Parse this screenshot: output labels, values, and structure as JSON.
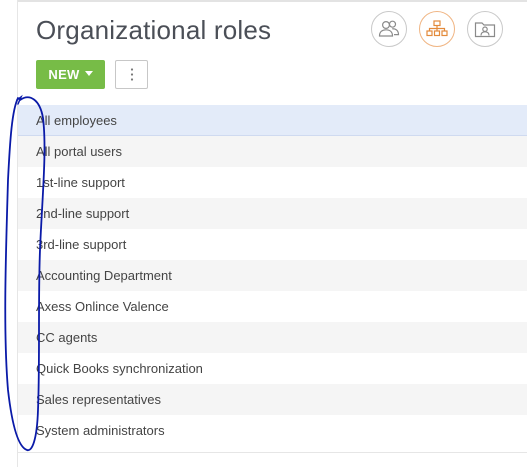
{
  "header": {
    "title": "Organizational roles",
    "view_buttons": [
      {
        "icon": "users-icon"
      },
      {
        "icon": "org-chart-icon",
        "active": true
      },
      {
        "icon": "user-folder-icon"
      }
    ]
  },
  "toolbar": {
    "new_label": "NEW",
    "more_icon": "vertical-dots-icon"
  },
  "roles": [
    "All employees",
    "All portal users",
    "1st-line support",
    "2nd-line support",
    "3rd-line support",
    "Accounting Department",
    "Axess Onlince Valence",
    "CC agents",
    "Quick Books synchronization",
    "Sales representatives",
    "System administrators"
  ],
  "selected_index": 0,
  "colors": {
    "new_button": "#77bc47",
    "selected_row": "#e3ebf9",
    "alt_row": "#f5f5f5",
    "active_view_border": "#f0b583",
    "active_view_icon": "#e38a3b",
    "annotation_ink": "#0a1aa8"
  }
}
